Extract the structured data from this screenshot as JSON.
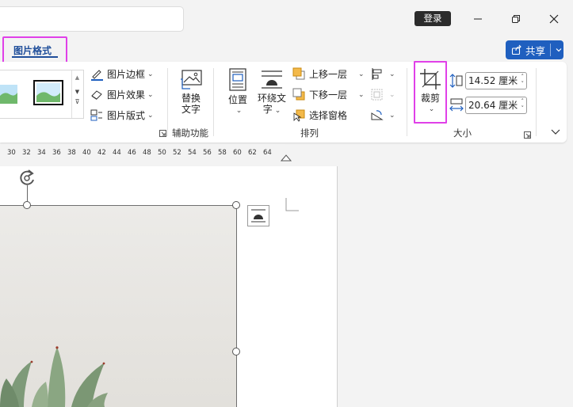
{
  "titlebar": {
    "login_label": "登录"
  },
  "tabs": {
    "picture_format_label": "图片格式"
  },
  "share": {
    "label": "共享"
  },
  "ribbon": {
    "styles_group": {
      "border_label": "图片边框",
      "effects_label": "图片效果",
      "layout_label": "图片版式"
    },
    "accessibility_group": {
      "alt_text_line1": "替换",
      "alt_text_line2": "文字",
      "group_label": "辅助功能"
    },
    "arrange_group": {
      "position_label": "位置",
      "wrap_line1": "环绕文",
      "wrap_line2": "字",
      "bring_forward_label": "上移一层",
      "send_backward_label": "下移一层",
      "selection_pane_label": "选择窗格",
      "group_label": "排列"
    },
    "size_group": {
      "crop_label": "裁剪",
      "height_value": "14.52 厘米",
      "width_value": "20.64 厘米",
      "group_label": "大小"
    }
  },
  "ruler": {
    "ticks": [
      "30",
      "32",
      "34",
      "36",
      "38",
      "40",
      "42",
      "44",
      "46",
      "48",
      "50",
      "52",
      "54",
      "56",
      "58",
      "60",
      "62",
      "64"
    ]
  },
  "colors": {
    "accent": "#1f5fbf",
    "highlight": "#e040e8",
    "tab_text": "#1f4e9a"
  }
}
